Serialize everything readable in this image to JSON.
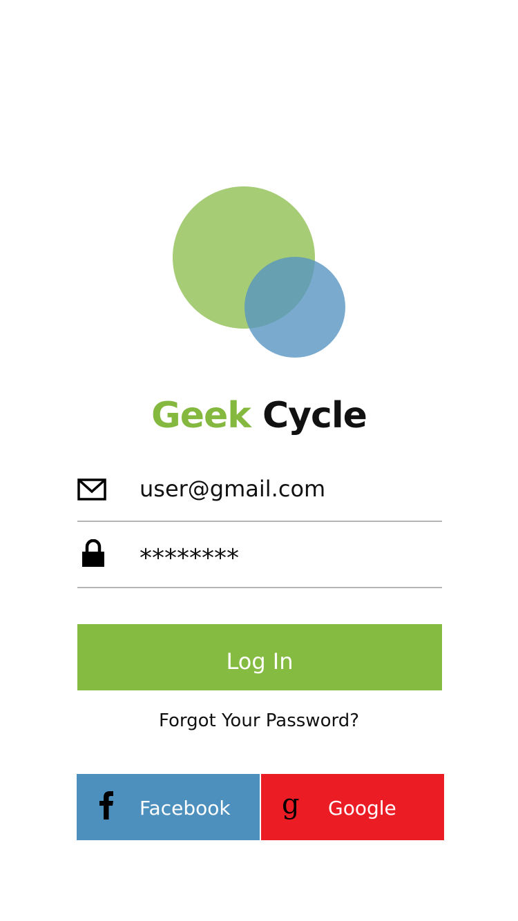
{
  "logo": {
    "icon": "overlapping-circles-logo",
    "colors": {
      "large_circle": "#a4cb71",
      "small_circle": "#6fa4cb"
    }
  },
  "brand": {
    "first_word": "Geek",
    "second_word": "Cycle"
  },
  "email_field": {
    "icon": "envelope-icon",
    "value": "user@gmail.com"
  },
  "password_field": {
    "icon": "lock-icon",
    "value": "********"
  },
  "login_button": {
    "label": "Log In"
  },
  "forgot_link": {
    "label": "Forgot Your Password?"
  },
  "social": {
    "facebook": {
      "icon": "facebook-icon",
      "label": "Facebook"
    },
    "google": {
      "icon": "google-icon",
      "label": "Google"
    }
  },
  "colors": {
    "accent_green": "#84bb40",
    "facebook_blue": "#4e90bd",
    "google_red": "#ec1c24",
    "divider": "#b4b4b4"
  }
}
